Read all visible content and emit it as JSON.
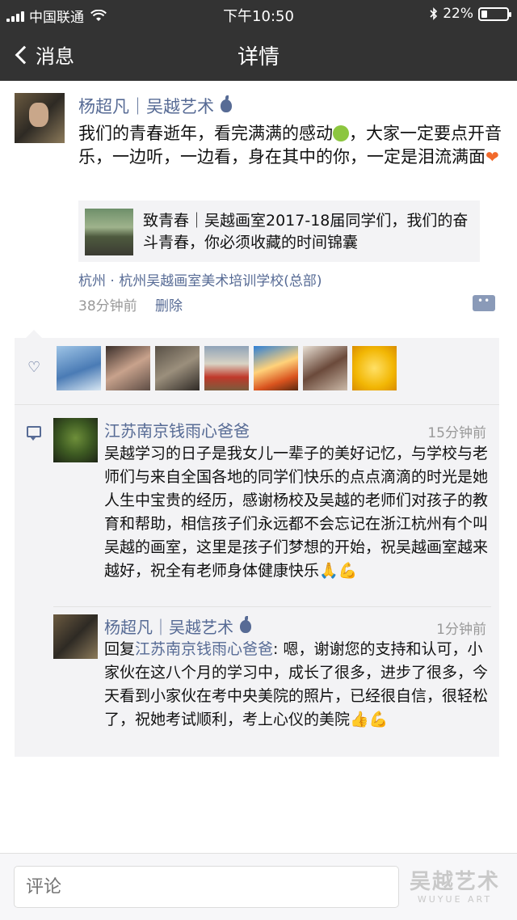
{
  "status_bar": {
    "carrier": "中国联通",
    "time": "下午10:50",
    "battery": "22%",
    "battery_level": 0.22
  },
  "nav": {
    "back_label": "消息",
    "title": "详情"
  },
  "post": {
    "author": "杨超凡｜吴越艺术",
    "text_1": "我们的青春逝年，看完满满的感动",
    "text_2": "，大家一定要点开音乐，一边听，一边看，身在其中的你，一定是泪流满面",
    "share_title": "致青春｜吴越画室2017-18届同学们，我们的奋斗青春，你必须收藏的时间锦囊",
    "location": "杭州 · 杭州吴越画室美术培训学校(总部)",
    "time": "38分钟前",
    "delete_label": "删除"
  },
  "likes": {
    "avatar_count": 7
  },
  "comments": [
    {
      "name": "江苏南京钱雨心爸爸",
      "time": "15分钟前",
      "text": "吴越学习的日子是我女儿一辈子的美好记忆，与学校与老师们与来自全国各地的同学们快乐的点点滴滴的时光是她人生中宝贵的经历，感谢杨校及吴越的老师们对孩子的教育和帮助，相信孩子们永远都不会忘记在浙江杭州有个叫吴越的画室，这里是孩子们梦想的开始，祝吴越画室越来越好，祝全有老师身体健康快乐🙏💪"
    },
    {
      "name": "杨超凡｜吴越艺术",
      "time": "1分钟前",
      "reply_prefix": "回复",
      "reply_to": "江苏南京钱雨心爸爸",
      "text": ": 嗯，谢谢您的支持和认可，小家伙在这八个月的学习中，成长了很多，进步了很多，今天看到小家伙在考中央美院的照片，已经很自信，很轻松了，祝她考试顺利，考上心仪的美院👍💪"
    }
  ],
  "input": {
    "placeholder": "评论"
  },
  "watermark": {
    "line1": "吴越艺术",
    "line2": "WUYUE ART"
  },
  "colors": {
    "bar": "#333333",
    "link": "#576b95",
    "panel": "#f3f3f5"
  }
}
